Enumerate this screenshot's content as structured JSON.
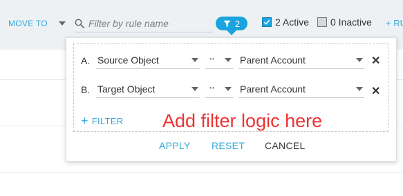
{
  "toolbar": {
    "move_to_label": "MOVE TO",
    "search_placeholder": "Filter by rule name",
    "filter_count": "2",
    "active_label": "2 Active",
    "active_checked": true,
    "inactive_label": "0 Inactive",
    "inactive_checked": false,
    "add_rule_label": "+ RU"
  },
  "filter_panel": {
    "rows": [
      {
        "letter": "A.",
        "field": "Source Object",
        "operator_icon": "double-arrow-icon",
        "value": "Parent Account"
      },
      {
        "letter": "B.",
        "field": "Target Object",
        "operator_icon": "double-arrow-icon",
        "value": "Parent Account"
      }
    ],
    "add_filter_label": "FILTER",
    "hint_text": "Add filter logic here",
    "apply_label": "APPLY",
    "reset_label": "RESET",
    "cancel_label": "CANCEL"
  },
  "colors": {
    "accent": "#1aa3de",
    "link": "#34a7d9",
    "hint": "#ee3333",
    "toolbar_bg": "#eef1f4"
  }
}
